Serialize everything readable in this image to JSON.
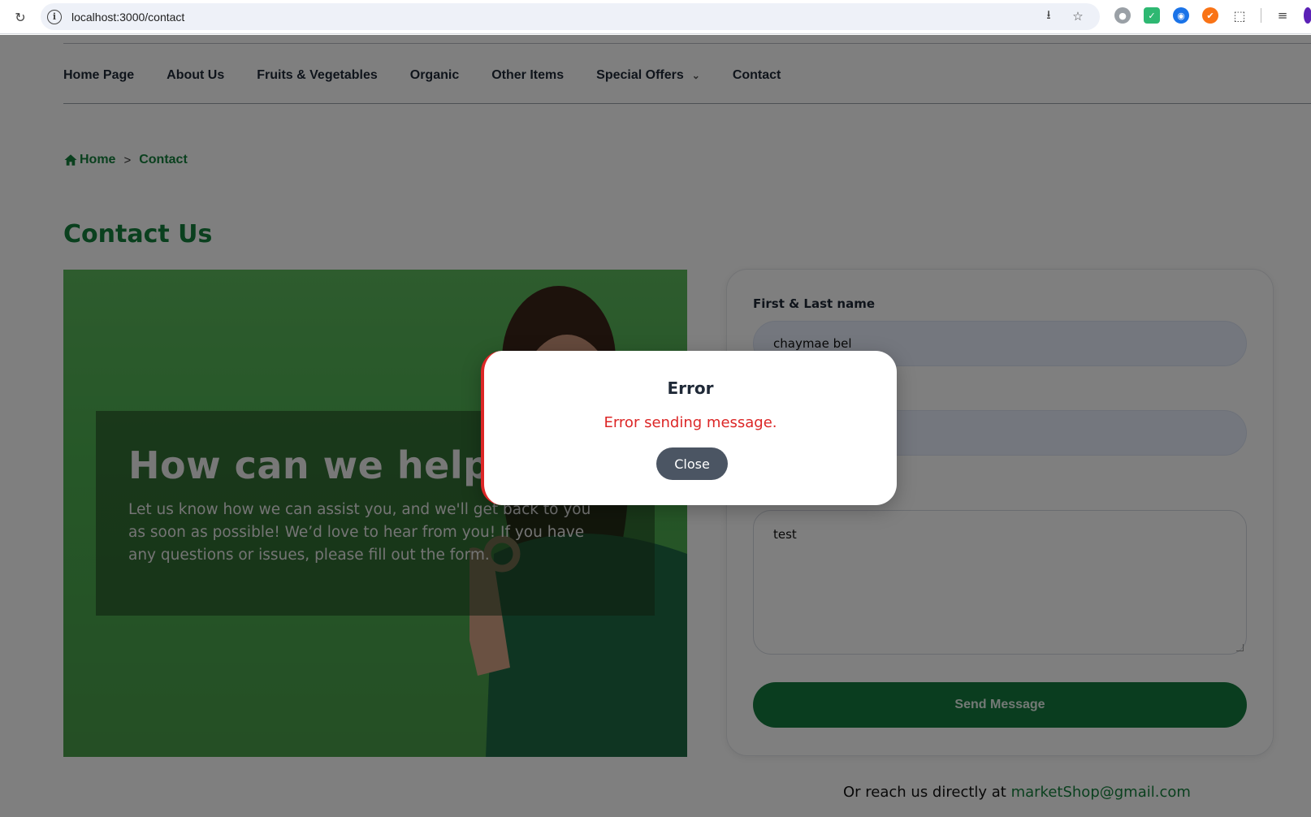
{
  "browser": {
    "url": "localhost:3000/contact"
  },
  "nav": {
    "items": [
      "Home Page",
      "About Us",
      "Fruits & Vegetables",
      "Organic",
      "Other Items",
      "Special Offers",
      "Contact"
    ]
  },
  "breadcrumb": {
    "home": "Home",
    "separator": ">",
    "current": "Contact"
  },
  "page": {
    "title": "Contact Us"
  },
  "hero": {
    "heading": "How can we help you?",
    "text": "Let us know how we can assist you, and we'll get back to you as soon as possible! We’d love to hear from you! If you have any questions or issues, please fill out the form."
  },
  "form": {
    "name_label": "First & Last name",
    "name_value": "chaymae bel",
    "message_value": "test",
    "send_label": "Send Message"
  },
  "reach": {
    "prefix": "Or reach us directly at",
    "email": "marketShop@gmail.com"
  },
  "modal": {
    "title": "Error",
    "message": "Error sending message.",
    "close_label": "Close"
  },
  "colors": {
    "brand_green": "#15803d",
    "button_green": "#157a3f",
    "error_red": "#dc2626",
    "close_gray": "#4b5563"
  }
}
